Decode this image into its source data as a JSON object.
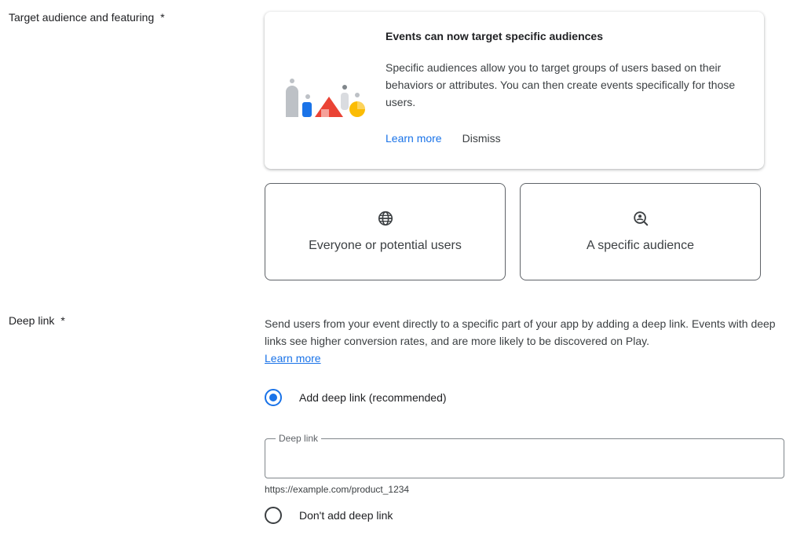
{
  "target_audience": {
    "label": "Target audience and featuring",
    "required_mark": "*",
    "banner": {
      "title": "Events can now target specific audiences",
      "body": "Specific audiences allow you to target groups of users based on their behaviors or attributes. You can then create events specifically for those users.",
      "learn_more": "Learn more",
      "dismiss": "Dismiss"
    },
    "options": [
      {
        "label": "Everyone or potential users",
        "icon": "globe-icon"
      },
      {
        "label": "A specific audience",
        "icon": "audience-search-icon"
      }
    ]
  },
  "deep_link": {
    "label": "Deep link",
    "required_mark": "*",
    "description": "Send users from your event directly to a specific part of your app by adding a deep link. Events with deep links see higher conversion rates, and are more likely to be discovered on Play.",
    "learn_more": "Learn more",
    "add_option": "Add deep link (recommended)",
    "field_label": "Deep link",
    "field_value": "",
    "helper": "https://example.com/product_1234",
    "dont_add_option": "Don't add deep link"
  },
  "colors": {
    "accent": "#1a73e8",
    "illustration_red": "#ea4335",
    "illustration_blue": "#1a73e8",
    "illustration_yellow": "#fbbc04",
    "illustration_gray": "#bdc1c6"
  }
}
